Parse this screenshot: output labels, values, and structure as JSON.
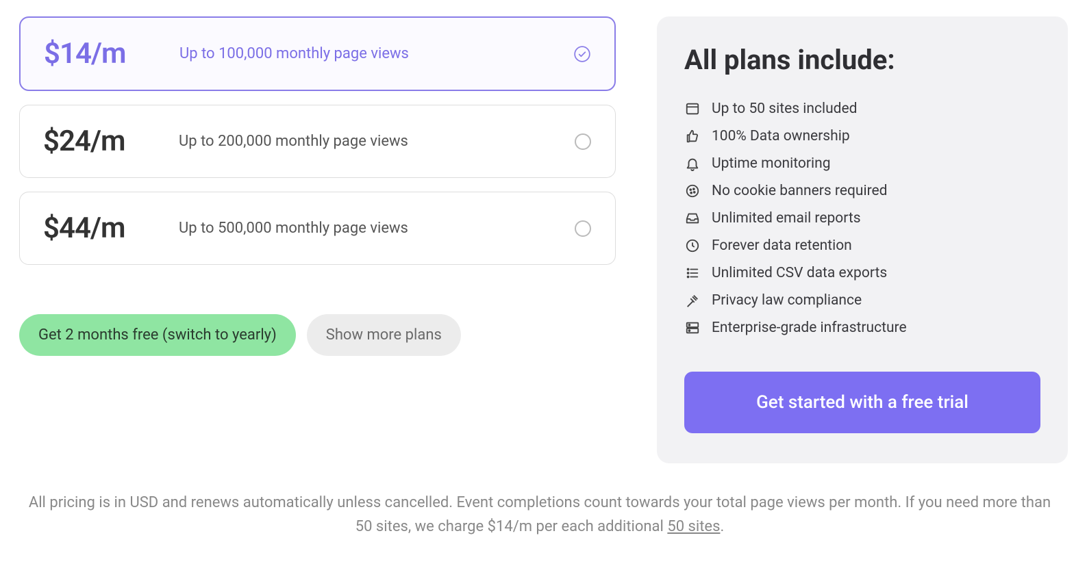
{
  "plans": [
    {
      "price": "$14/m",
      "desc": "Up to 100,000 monthly page views",
      "selected": true
    },
    {
      "price": "$24/m",
      "desc": "Up to 200,000 monthly page views",
      "selected": false
    },
    {
      "price": "$44/m",
      "desc": "Up to 500,000 monthly page views",
      "selected": false
    }
  ],
  "actions": {
    "yearly_switch": "Get 2 months free (switch to yearly)",
    "show_more": "Show more plans"
  },
  "includes": {
    "title": "All plans include:",
    "features": [
      {
        "icon": "browser-icon",
        "label": "Up to 50 sites included"
      },
      {
        "icon": "thumbs-up-icon",
        "label": "100% Data ownership"
      },
      {
        "icon": "bell-icon",
        "label": "Uptime monitoring"
      },
      {
        "icon": "cookie-icon",
        "label": "No cookie banners required"
      },
      {
        "icon": "inbox-icon",
        "label": "Unlimited email reports"
      },
      {
        "icon": "clock-icon",
        "label": "Forever data retention"
      },
      {
        "icon": "list-icon",
        "label": "Unlimited CSV data exports"
      },
      {
        "icon": "gavel-icon",
        "label": "Privacy law compliance"
      },
      {
        "icon": "server-icon",
        "label": "Enterprise-grade infrastructure"
      }
    ],
    "cta": "Get started with a free trial"
  },
  "disclaimer": {
    "text_before": "All pricing is in USD and renews automatically unless cancelled. Event completions count towards your total page views per month. If you need more than 50 sites, we charge $14/m per each additional ",
    "link_text": "50 sites",
    "text_after": "."
  }
}
